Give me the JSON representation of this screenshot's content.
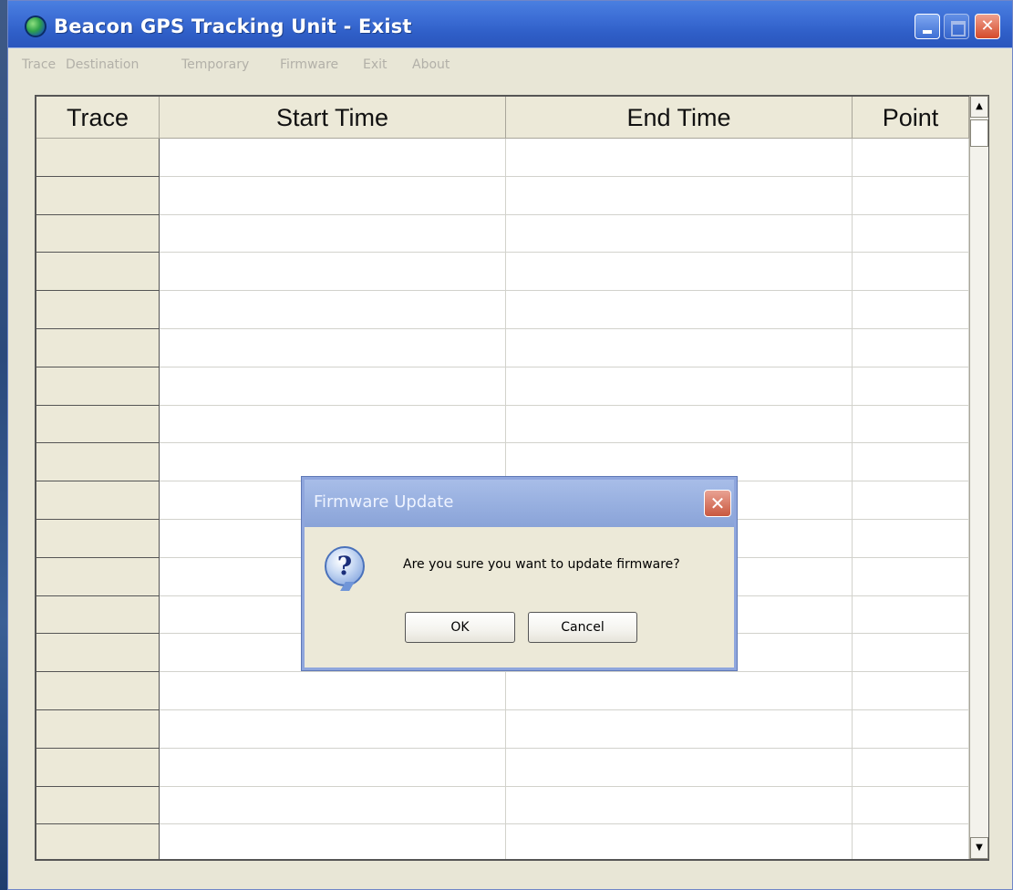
{
  "window": {
    "title": "Beacon GPS Tracking Unit - Exist",
    "icon": "globe-icon",
    "controls": [
      "minimize",
      "maximize",
      "close"
    ]
  },
  "menu": [
    "Trace",
    "Destination",
    "Temporary",
    "Firmware",
    "Exit",
    "About"
  ],
  "table": {
    "columns": [
      "Trace",
      "Start Time",
      "End Time",
      "Point"
    ],
    "rows": [
      [
        "",
        "",
        "",
        ""
      ],
      [
        "",
        "",
        "",
        ""
      ],
      [
        "",
        "",
        "",
        ""
      ],
      [
        "",
        "",
        "",
        ""
      ],
      [
        "",
        "",
        "",
        ""
      ],
      [
        "",
        "",
        "",
        ""
      ],
      [
        "",
        "",
        "",
        ""
      ],
      [
        "",
        "",
        "",
        ""
      ],
      [
        "",
        "",
        "",
        ""
      ],
      [
        "",
        "",
        "",
        ""
      ],
      [
        "",
        "",
        "",
        ""
      ],
      [
        "",
        "",
        "",
        ""
      ],
      [
        "",
        "",
        "",
        ""
      ],
      [
        "",
        "",
        "",
        ""
      ],
      [
        "",
        "",
        "",
        ""
      ],
      [
        "",
        "",
        "",
        ""
      ],
      [
        "",
        "",
        "",
        ""
      ],
      [
        "",
        "",
        "",
        ""
      ],
      [
        "",
        "",
        "",
        ""
      ]
    ]
  },
  "dialog": {
    "title": "Firmware Update",
    "icon": "question-icon",
    "message": "Are you sure you want to update firmware?",
    "ok_label": "OK",
    "cancel_label": "Cancel"
  },
  "colors": {
    "titlebar": "#3d6fd6",
    "dialog_titlebar": "#98b0e0",
    "window_bg": "#ece9d8"
  }
}
